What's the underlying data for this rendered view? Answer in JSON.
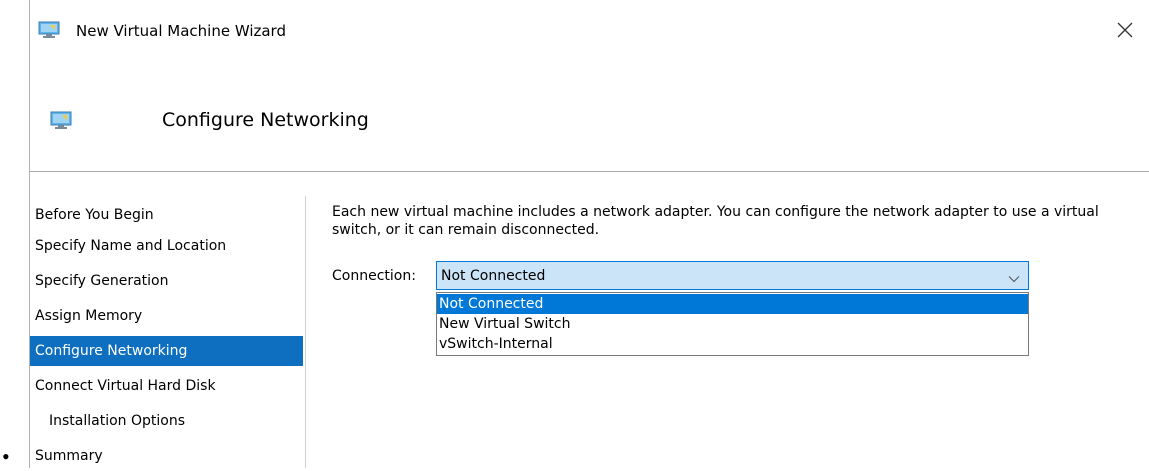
{
  "window": {
    "title": "New Virtual Machine Wizard",
    "icon": "monitor-icon",
    "close_icon": "close-icon"
  },
  "header": {
    "title": "Configure Networking",
    "icon": "monitor-icon"
  },
  "list_bullet": "•",
  "nav": {
    "items": [
      {
        "label": "Before You Begin",
        "selected": false,
        "indent": false
      },
      {
        "label": "Specify Name and Location",
        "selected": false,
        "indent": false
      },
      {
        "label": "Specify Generation",
        "selected": false,
        "indent": false
      },
      {
        "label": "Assign Memory",
        "selected": false,
        "indent": false
      },
      {
        "label": "Configure Networking",
        "selected": true,
        "indent": false
      },
      {
        "label": "Connect Virtual Hard Disk",
        "selected": false,
        "indent": false
      },
      {
        "label": "Installation Options",
        "selected": false,
        "indent": true
      },
      {
        "label": "Summary",
        "selected": false,
        "indent": false
      }
    ]
  },
  "main": {
    "description": "Each new virtual machine includes a network adapter. You can configure the network adapter to use a virtual switch, or it can remain disconnected.",
    "connection_label": "Connection:",
    "connection_value": "Not Connected",
    "dropdown_icon": "chevron-down-icon",
    "options": [
      {
        "label": "Not Connected",
        "selected": true
      },
      {
        "label": "New Virtual Switch",
        "selected": false
      },
      {
        "label": "vSwitch-Internal",
        "selected": false
      }
    ]
  },
  "colors": {
    "nav_selected_bg": "#0e6fc1",
    "select_bg": "#cce4f7",
    "select_border": "#0078d7",
    "option_selected_bg": "#0078d7"
  }
}
